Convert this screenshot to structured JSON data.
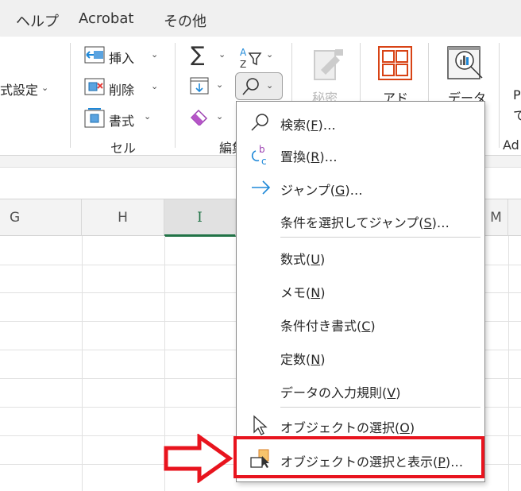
{
  "menubar": {
    "tabs": [
      "ヘルプ",
      "Acrobat",
      "その他"
    ]
  },
  "ribbon": {
    "format_label": "式設定",
    "cells": {
      "insert": "挿入",
      "delete": "削除",
      "format": "書式",
      "group": "セル"
    },
    "editing": {
      "group": "編集"
    },
    "sensitivity": "秘密",
    "addins": "アド",
    "data_analysis": "データ",
    "partial_p": "P",
    "partial_te": "て",
    "partial_group": "Ad"
  },
  "columns": [
    "G",
    "H",
    "I",
    "M"
  ],
  "selected_column": "I",
  "menu": {
    "items": [
      {
        "pre": "検索(",
        "key": "F",
        "post": ")…",
        "icon": "search-icon"
      },
      {
        "pre": "置換(",
        "key": "R",
        "post": ")…",
        "icon": "replace-icon"
      },
      {
        "pre": "ジャンプ(",
        "key": "G",
        "post": ")…",
        "icon": "arrow-right-icon"
      },
      {
        "pre": "条件を選択してジャンプ(",
        "key": "S",
        "post": ")…",
        "icon": ""
      },
      {
        "pre": "数式(",
        "key": "U",
        "post": ")",
        "icon": ""
      },
      {
        "pre": "メモ(",
        "key": "N",
        "post": ")",
        "icon": ""
      },
      {
        "pre": "条件付き書式(",
        "key": "C",
        "post": ")",
        "icon": ""
      },
      {
        "pre": "定数(",
        "key": "N",
        "post": ")",
        "icon": ""
      },
      {
        "pre": "データの入力規則(",
        "key": "V",
        "post": ")",
        "icon": ""
      },
      {
        "pre": "オブジェクトの選択(",
        "key": "O",
        "post": ")",
        "icon": "cursor-icon"
      },
      {
        "pre": "オブジェクトの選択と表示(",
        "key": "P",
        "post": ")…",
        "icon": "selection-pane-icon"
      }
    ]
  },
  "colors": {
    "highlight": "#e8141e",
    "accent_green": "#217346",
    "icon_blue": "#1e88d8"
  }
}
